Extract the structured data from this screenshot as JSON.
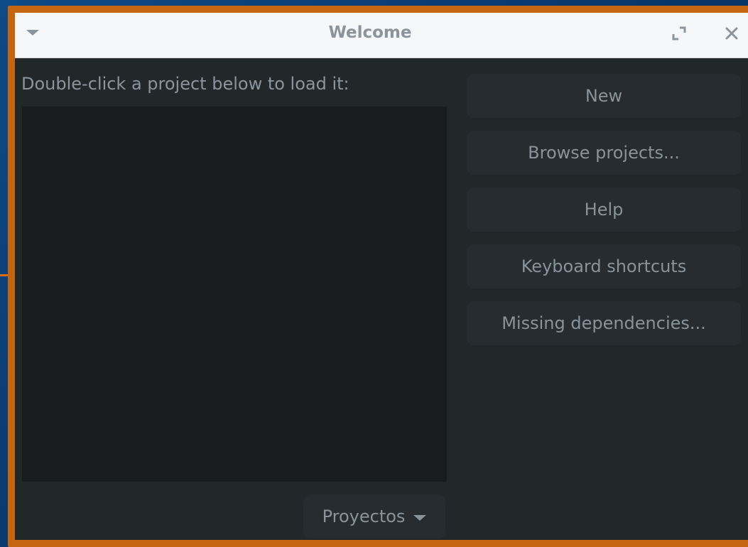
{
  "window": {
    "title": "Welcome",
    "menu_icon": "chevron-down-icon",
    "maximize_icon": "maximize-icon",
    "close_icon": "close-icon"
  },
  "main": {
    "instruction": "Double-click a project below to load it:",
    "projects": [],
    "folder_dropdown": {
      "label": "Proyectos",
      "icon": "chevron-down-icon"
    }
  },
  "actions": [
    {
      "label": "New"
    },
    {
      "label": "Browse projects..."
    },
    {
      "label": "Help"
    },
    {
      "label": "Keyboard shortcuts"
    },
    {
      "label": "Missing dependencies..."
    }
  ],
  "colors": {
    "window_border": "#c6650f",
    "titlebar_bg": "#f6f7f8",
    "content_bg": "#22272a",
    "list_bg": "#181c1e",
    "button_bg": "#262c30",
    "text": "#89939b"
  }
}
